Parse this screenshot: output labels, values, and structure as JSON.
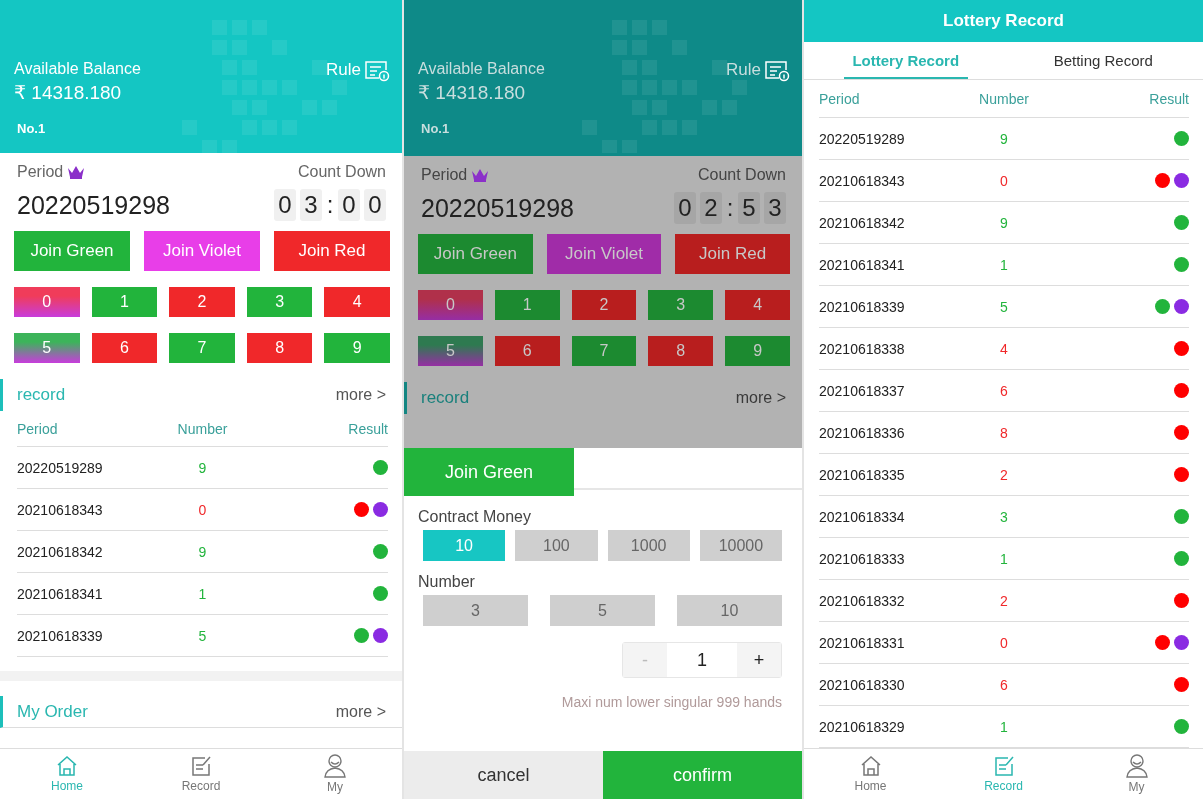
{
  "home_screen": {
    "header": {
      "balance_label": "Available Balance",
      "balance": "₹ 14318.180",
      "rule": "Rule",
      "rank": "No.1"
    },
    "period_label": "Period",
    "period": "20220519298",
    "countdown_label": "Count Down",
    "countdown": {
      "minutes": [
        "0",
        "3"
      ],
      "separator": ":",
      "seconds": [
        "0",
        "0"
      ]
    },
    "join_buttons": [
      {
        "label": "Join Green",
        "color": "#22b43c"
      },
      {
        "label": "Join Violet",
        "color": "#e83ee8"
      },
      {
        "label": "Join Red",
        "color": "#f0282a"
      }
    ],
    "numbers": [
      {
        "label": "0",
        "kind": "mixed",
        "color": "#f03c5a"
      },
      {
        "label": "1",
        "kind": "solid",
        "color": "#22b43c"
      },
      {
        "label": "2",
        "kind": "solid",
        "color": "#f0282a"
      },
      {
        "label": "3",
        "kind": "solid",
        "color": "#22b43c"
      },
      {
        "label": "4",
        "kind": "solid",
        "color": "#f0282a"
      },
      {
        "label": "5",
        "kind": "mixed",
        "color": "#3cb45a"
      },
      {
        "label": "6",
        "kind": "solid",
        "color": "#f0282a"
      },
      {
        "label": "7",
        "kind": "solid",
        "color": "#22b43c"
      },
      {
        "label": "8",
        "kind": "solid",
        "color": "#f0282a"
      },
      {
        "label": "9",
        "kind": "solid",
        "color": "#22b43c"
      }
    ],
    "record": {
      "title": "record",
      "more": "more >",
      "columns": [
        "Period",
        "Number",
        "Result"
      ],
      "rows": [
        {
          "period": "20220519289",
          "number": "9",
          "color": "#22b43c",
          "results": [
            {
              "color": "#22b43c"
            }
          ]
        },
        {
          "period": "20210618343",
          "number": "0",
          "color": "#f0282a",
          "results": [
            {
              "color": "#ff0000"
            },
            {
              "color": "#8a2be2"
            }
          ]
        },
        {
          "period": "20210618342",
          "number": "9",
          "color": "#22b43c",
          "results": [
            {
              "color": "#22b43c"
            }
          ]
        },
        {
          "period": "20210618341",
          "number": "1",
          "color": "#22b43c",
          "results": [
            {
              "color": "#22b43c"
            }
          ]
        },
        {
          "period": "20210618339",
          "number": "5",
          "color": "#22b43c",
          "results": [
            {
              "color": "#22b43c"
            },
            {
              "color": "#8a2be2"
            }
          ]
        }
      ]
    },
    "my_order": {
      "title": "My Order",
      "more": "more >"
    },
    "tab_bar": [
      {
        "label": "Home",
        "selected": true
      },
      {
        "label": "Record",
        "selected": false
      },
      {
        "label": "My",
        "selected": false
      }
    ]
  },
  "betting_screen": {
    "header": {
      "balance_label": "Available Balance",
      "balance": "₹ 14318.180",
      "rule": "Rule",
      "rank": "No.1"
    },
    "period_label": "Period",
    "period": "20220519298",
    "countdown_label": "Count Down",
    "countdown": {
      "minutes": [
        "0",
        "2"
      ],
      "separator": ":",
      "seconds": [
        "5",
        "3"
      ]
    },
    "join_buttons": [
      {
        "label": "Join Green",
        "color": "#1c8a30"
      },
      {
        "label": "Join Violet",
        "color": "#a02ca8"
      },
      {
        "label": "Join Red",
        "color": "#b81e1e"
      }
    ],
    "numbers": [
      {
        "label": "0",
        "kind": "mixed",
        "color": "#b0304a"
      },
      {
        "label": "1",
        "kind": "solid",
        "color": "#1c8a30"
      },
      {
        "label": "2",
        "kind": "solid",
        "color": "#b81e1e"
      },
      {
        "label": "3",
        "kind": "solid",
        "color": "#1c8a30"
      },
      {
        "label": "4",
        "kind": "solid",
        "color": "#b81e1e"
      },
      {
        "label": "5",
        "kind": "mixed",
        "color": "#2e7a50"
      },
      {
        "label": "6",
        "kind": "solid",
        "color": "#b81e1e"
      },
      {
        "label": "7",
        "kind": "solid",
        "color": "#1c8a30"
      },
      {
        "label": "8",
        "kind": "solid",
        "color": "#b81e1e"
      },
      {
        "label": "9",
        "kind": "solid",
        "color": "#1c8a30"
      }
    ],
    "record": {
      "title": "record",
      "more": "more >"
    },
    "sheet": {
      "title": "Join Green",
      "color": "#22b43c",
      "contract_label": "Contract Money",
      "amounts": [
        {
          "label": "10",
          "selected": true
        },
        {
          "label": "100",
          "selected": false
        },
        {
          "label": "1000",
          "selected": false
        },
        {
          "label": "10000",
          "selected": false
        }
      ],
      "number_label": "Number",
      "multipliers": [
        {
          "label": "3",
          "selected": false
        },
        {
          "label": "5",
          "selected": false
        },
        {
          "label": "10",
          "selected": false
        }
      ],
      "stepper": {
        "minus": "-",
        "value": "1",
        "plus": "+"
      },
      "note": "Maxi num lower singular 999 hands",
      "cancel": "cancel",
      "confirm": "confirm"
    }
  },
  "record_screen": {
    "title": "Lottery Record",
    "tabs": [
      {
        "label": "Lottery Record",
        "selected": true
      },
      {
        "label": "Betting Record",
        "selected": false
      }
    ],
    "columns": [
      "Period",
      "Number",
      "Result"
    ],
    "rows": [
      {
        "period": "20220519289",
        "number": "9",
        "color": "#22b43c",
        "results": [
          {
            "color": "#22b43c"
          }
        ]
      },
      {
        "period": "20210618343",
        "number": "0",
        "color": "#f0282a",
        "results": [
          {
            "color": "#ff0000"
          },
          {
            "color": "#8a2be2"
          }
        ]
      },
      {
        "period": "20210618342",
        "number": "9",
        "color": "#22b43c",
        "results": [
          {
            "color": "#22b43c"
          }
        ]
      },
      {
        "period": "20210618341",
        "number": "1",
        "color": "#22b43c",
        "results": [
          {
            "color": "#22b43c"
          }
        ]
      },
      {
        "period": "20210618339",
        "number": "5",
        "color": "#22b43c",
        "results": [
          {
            "color": "#22b43c"
          },
          {
            "color": "#8a2be2"
          }
        ]
      },
      {
        "period": "20210618338",
        "number": "4",
        "color": "#f0282a",
        "results": [
          {
            "color": "#ff0000"
          }
        ]
      },
      {
        "period": "20210618337",
        "number": "6",
        "color": "#f0282a",
        "results": [
          {
            "color": "#ff0000"
          }
        ]
      },
      {
        "period": "20210618336",
        "number": "8",
        "color": "#f0282a",
        "results": [
          {
            "color": "#ff0000"
          }
        ]
      },
      {
        "period": "20210618335",
        "number": "2",
        "color": "#f0282a",
        "results": [
          {
            "color": "#ff0000"
          }
        ]
      },
      {
        "period": "20210618334",
        "number": "3",
        "color": "#22b43c",
        "results": [
          {
            "color": "#22b43c"
          }
        ]
      },
      {
        "period": "20210618333",
        "number": "1",
        "color": "#22b43c",
        "results": [
          {
            "color": "#22b43c"
          }
        ]
      },
      {
        "period": "20210618332",
        "number": "2",
        "color": "#f0282a",
        "results": [
          {
            "color": "#ff0000"
          }
        ]
      },
      {
        "period": "20210618331",
        "number": "0",
        "color": "#f0282a",
        "results": [
          {
            "color": "#ff0000"
          },
          {
            "color": "#8a2be2"
          }
        ]
      },
      {
        "period": "20210618330",
        "number": "6",
        "color": "#f0282a",
        "results": [
          {
            "color": "#ff0000"
          }
        ]
      },
      {
        "period": "20210618329",
        "number": "1",
        "color": "#22b43c",
        "results": [
          {
            "color": "#22b43c"
          }
        ]
      }
    ],
    "tab_bar": [
      {
        "label": "Home",
        "selected": false
      },
      {
        "label": "Record",
        "selected": true
      },
      {
        "label": "My",
        "selected": false
      }
    ]
  }
}
